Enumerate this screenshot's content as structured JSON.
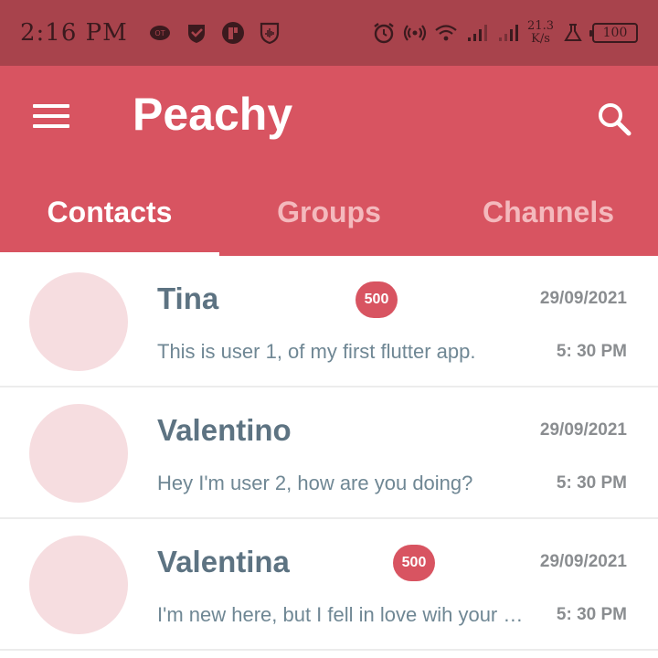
{
  "status_bar": {
    "time": "2:16 PM",
    "net_speed_value": "21.3",
    "net_speed_unit": "K/s",
    "battery": "100",
    "left_icons": [
      "o2-icon",
      "shield-check-icon",
      "app-p-icon",
      "shield-audio-icon"
    ],
    "right_icons": [
      "alarm-icon",
      "hotspot-icon",
      "wifi-icon",
      "signal-icon",
      "signal-icon",
      "data-saver-icon"
    ]
  },
  "app_bar": {
    "title": "Peachy",
    "menu_icon": "hamburger-menu-icon",
    "search_icon": "search-icon",
    "colors": {
      "status_bar": "#a8434c",
      "app_bar": "#d85461",
      "badge": "#d85461",
      "avatar": "#f6dde0"
    }
  },
  "tabs": [
    {
      "label": "Contacts",
      "active": true
    },
    {
      "label": "Groups",
      "active": false
    },
    {
      "label": "Channels",
      "active": false
    }
  ],
  "contacts": [
    {
      "name": "Tina",
      "badge": "500",
      "date": "29/09/2021",
      "message": "This is user 1, of my first flutter app.",
      "time": "5: 30 PM"
    },
    {
      "name": "Valentino",
      "badge": "",
      "date": "29/09/2021",
      "message": "Hey I'm user 2, how are you doing?",
      "time": "5: 30 PM"
    },
    {
      "name": "Valentina",
      "badge": "500",
      "date": "29/09/2021",
      "message": "I'm new here, but I fell in love wih your app.",
      "time": "5: 30 PM"
    }
  ]
}
